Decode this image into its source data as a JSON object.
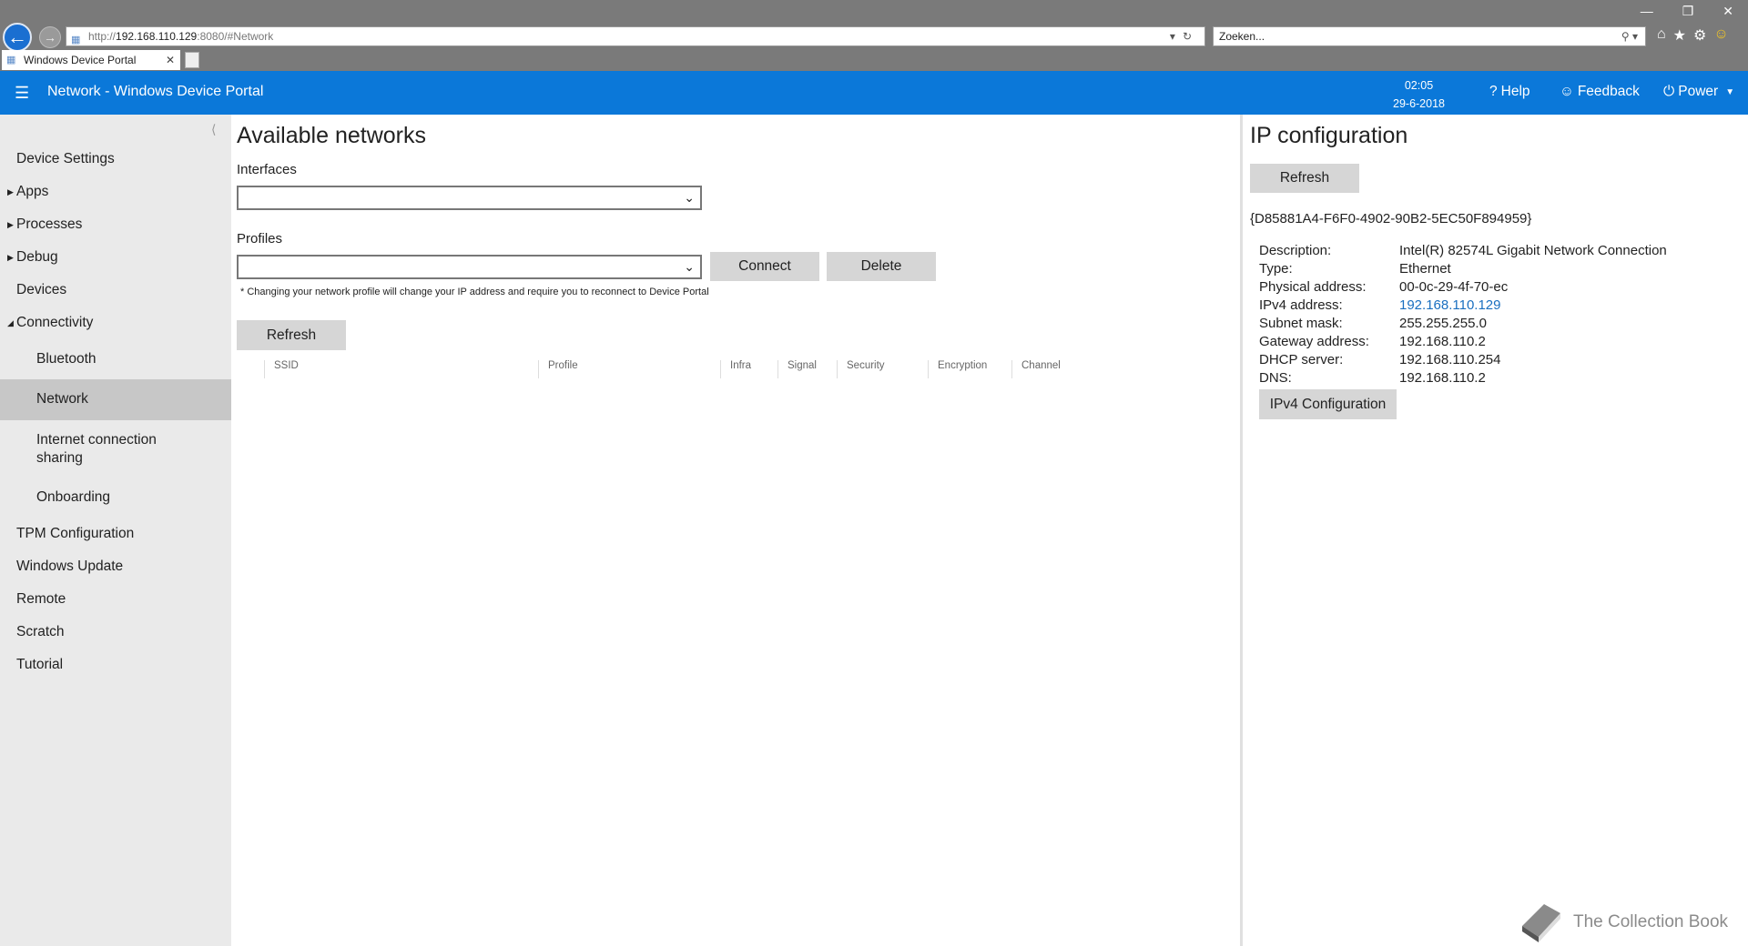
{
  "browser": {
    "url_prefix": "http://",
    "url_host": "192.168.110.129",
    "url_suffix": ":8080/#Network",
    "search_placeholder": "Zoeken...",
    "tab_title": "Windows Device Portal"
  },
  "header": {
    "title": "Network - Windows Device Portal",
    "time": "02:05",
    "date": "29-6-2018",
    "help": "Help",
    "feedback": "Feedback",
    "power": "Power"
  },
  "sidebar": {
    "items": [
      {
        "label": "Device Settings"
      },
      {
        "label": "Apps"
      },
      {
        "label": "Processes"
      },
      {
        "label": "Debug"
      },
      {
        "label": "Devices"
      },
      {
        "label": "Connectivity"
      },
      {
        "label": "Bluetooth"
      },
      {
        "label": "Network"
      },
      {
        "label": "Internet connection"
      },
      {
        "label": "sharing"
      },
      {
        "label": "Onboarding"
      },
      {
        "label": "TPM Configuration"
      },
      {
        "label": "Windows Update"
      },
      {
        "label": "Remote"
      },
      {
        "label": "Scratch"
      },
      {
        "label": "Tutorial"
      }
    ]
  },
  "main": {
    "title": "Available networks",
    "interfaces_label": "Interfaces",
    "interfaces_value": "",
    "profiles_label": "Profiles",
    "profiles_value": "",
    "connect_label": "Connect",
    "delete_label": "Delete",
    "note": "* Changing your network profile will change your IP address and require you to reconnect to Device Portal",
    "refresh_label": "Refresh",
    "columns": [
      "SSID",
      "Profile",
      "Infra",
      "Signal",
      "Security",
      "Encryption",
      "Channel"
    ]
  },
  "ip_config": {
    "title": "IP configuration",
    "refresh_label": "Refresh",
    "guid": "{D85881A4-F6F0-4902-90B2-5EC50F894959}",
    "rows": [
      {
        "label": "Description:",
        "value": "Intel(R) 82574L Gigabit Network Connection"
      },
      {
        "label": "Type:",
        "value": "Ethernet"
      },
      {
        "label": "Physical address:",
        "value": "00-0c-29-4f-70-ec"
      },
      {
        "label": "IPv4 address:",
        "value": "192.168.110.129"
      },
      {
        "label": "Subnet mask:",
        "value": "255.255.255.0"
      },
      {
        "label": "Gateway address:",
        "value": "192.168.110.2"
      },
      {
        "label": "DHCP server:",
        "value": "192.168.110.254"
      },
      {
        "label": "DNS:",
        "value": "192.168.110.2"
      }
    ],
    "ipv4_button": "IPv4 Configuration"
  },
  "watermark": "The Collection Book",
  "colors": {
    "header": "#0b78d9",
    "sidebar": "#eaeaea",
    "active_item": "#c7c7c7",
    "link": "#1a6fc0"
  }
}
